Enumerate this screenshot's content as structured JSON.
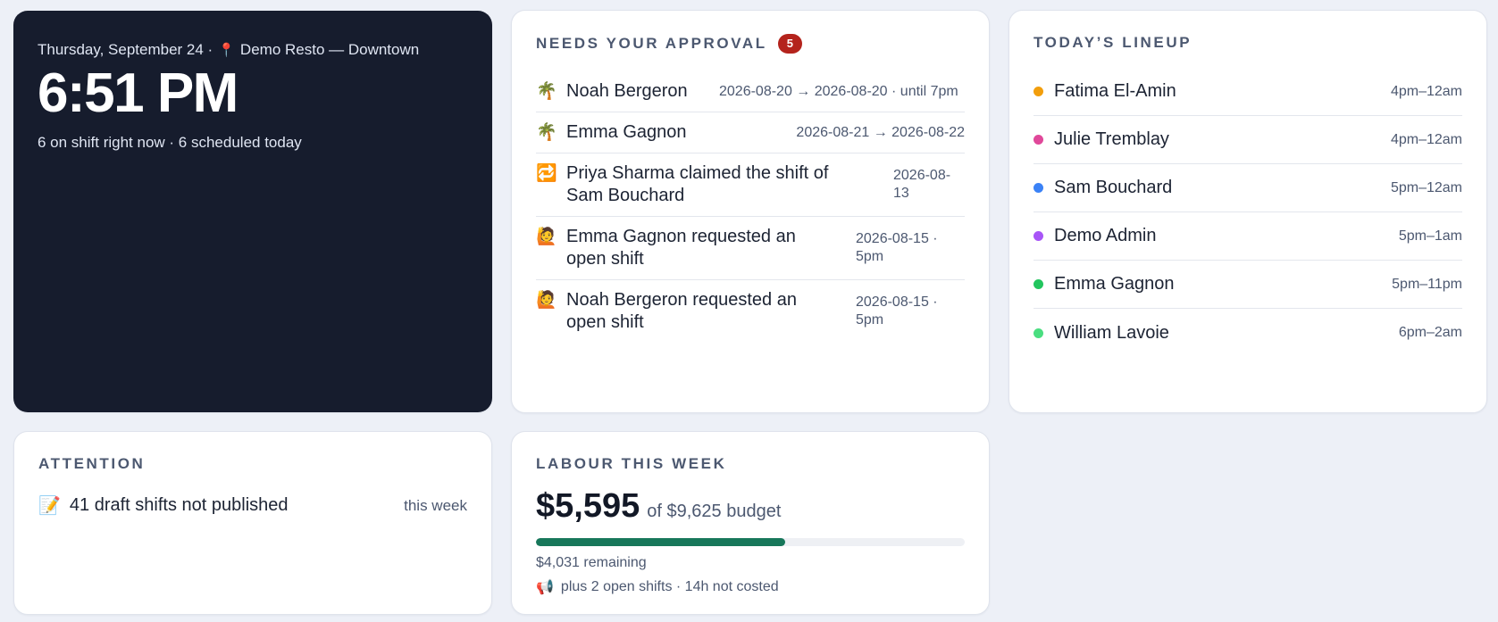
{
  "clock": {
    "date": "Thursday, September 24 ·",
    "location": "Demo Resto — Downtown",
    "time": "6:51 PM",
    "summary": "6 on shift right now · 6 scheduled today"
  },
  "approvals": {
    "title": "NEEDS YOUR APPROVAL",
    "count": "5",
    "items": [
      {
        "icon": "palm-tree-icon",
        "emoji": "🌴",
        "text": "Noah Bergeron",
        "date": "2026-08-20 → 2026-08-20 · until 7pm"
      },
      {
        "icon": "palm-tree-icon",
        "emoji": "🌴",
        "text": "Emma Gagnon",
        "date": "2026-08-21 → 2026-08-22"
      },
      {
        "icon": "swap-icon",
        "emoji": "🔁",
        "text": "Priya Sharma claimed the shift of Sam Bouchard",
        "date": "2026-08-13"
      },
      {
        "icon": "raised-hand-icon",
        "emoji": "🙋",
        "text": "Emma Gagnon requested an open shift",
        "date": "2026-08-15 · 5pm"
      },
      {
        "icon": "raised-hand-icon",
        "emoji": "🙋",
        "text": "Noah Bergeron requested an open shift",
        "date": "2026-08-15 · 5pm"
      }
    ]
  },
  "lineup": {
    "title": "TODAY’S LINEUP",
    "people": [
      {
        "name": "Fatima El-Amin",
        "time": "4pm–12am",
        "color": "#f29e0c"
      },
      {
        "name": "Julie Tremblay",
        "time": "4pm–12am",
        "color": "#e0489a"
      },
      {
        "name": "Sam Bouchard",
        "time": "5pm–12am",
        "color": "#3b82f6"
      },
      {
        "name": "Demo Admin",
        "time": "5pm–1am",
        "color": "#a855f7"
      },
      {
        "name": "Emma Gagnon",
        "time": "5pm–11pm",
        "color": "#22c55e"
      },
      {
        "name": "William Lavoie",
        "time": "6pm–2am",
        "color": "#4ade80"
      }
    ]
  },
  "attention": {
    "title": "ATTENTION",
    "icon": "memo-icon",
    "emoji": "📝",
    "text": "41 draft shifts not published",
    "scope": "this week"
  },
  "labour": {
    "title": "LABOUR THIS WEEK",
    "total": "$5,595",
    "budget": "of $9,625 budget",
    "progress_fraction": 0.581,
    "remaining": "$4,031 remaining",
    "note_icon": "megaphone-icon",
    "note_emoji": "📢",
    "note": "plus 2 open shifts · 14h not costed"
  }
}
